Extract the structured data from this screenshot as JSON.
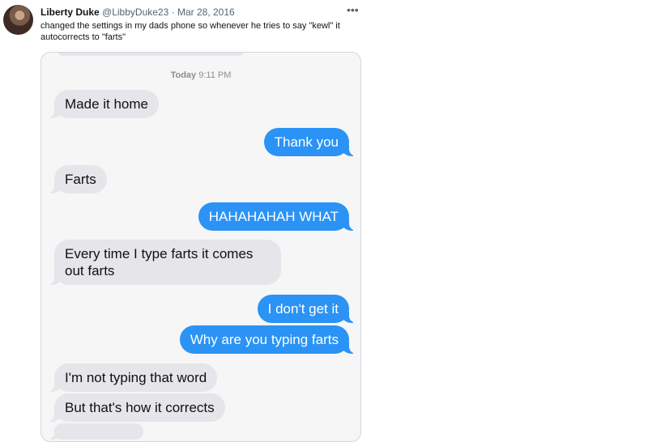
{
  "tweet": {
    "author_name": "Liberty Duke",
    "handle": "@LibbyDuke23",
    "separator": "·",
    "date": "Mar 28, 2016",
    "more_icon": "•••",
    "text": "changed the settings in my dads phone so whenever he tries to say \"kewl\" it autocorrects to \"farts\""
  },
  "conversation": {
    "timestamp_day": "Today",
    "timestamp_time": "9:11 PM",
    "messages": [
      {
        "from": "them",
        "text": "Made it home"
      },
      {
        "from": "me",
        "text": "Thank you"
      },
      {
        "from": "them",
        "text": "Farts"
      },
      {
        "from": "me",
        "text": "HAHAHAHAH WHAT"
      },
      {
        "from": "them",
        "text": "Every time I type farts it comes out farts"
      },
      {
        "from": "me",
        "text": "I don't get it"
      },
      {
        "from": "me",
        "text": "Why are you typing farts"
      },
      {
        "from": "them",
        "text": "I'm not typing that word"
      },
      {
        "from": "them",
        "text": "But that's how it corrects"
      }
    ]
  },
  "colors": {
    "incoming_bubble": "#e5e5ea",
    "outgoing_bubble": "#2a93f5",
    "chat_background": "#f6f6f6"
  }
}
